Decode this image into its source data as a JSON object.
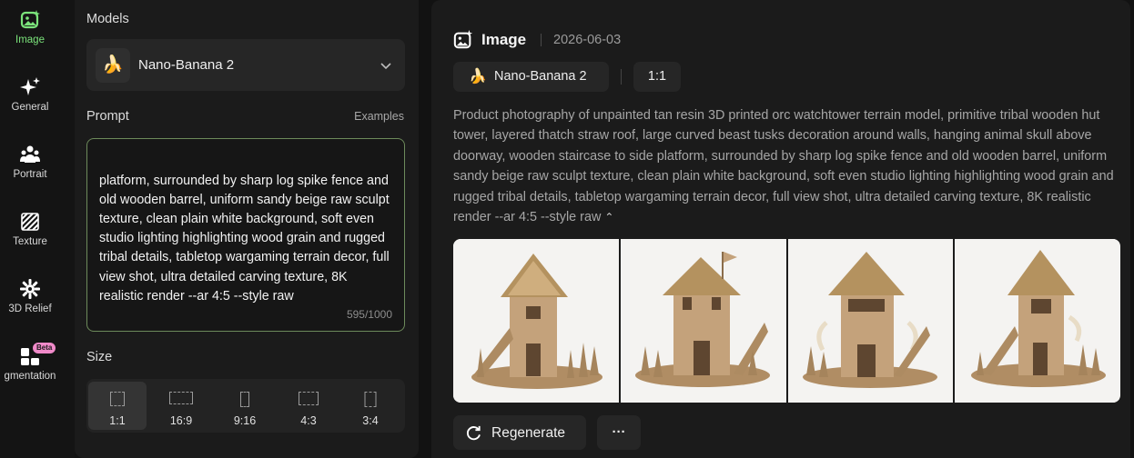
{
  "nav": {
    "items": [
      {
        "label": "Image",
        "icon": "image-sparkle-icon",
        "active": true
      },
      {
        "label": "General",
        "icon": "sparkle-icon"
      },
      {
        "label": "Portrait",
        "icon": "people-icon"
      },
      {
        "label": "Texture",
        "icon": "hatch-icon"
      },
      {
        "label": "3D Relief",
        "icon": "gear-star-icon"
      },
      {
        "label": "gmentation",
        "icon": "segmentation-icon",
        "badge": "Beta"
      }
    ]
  },
  "panel": {
    "models_title": "Models",
    "model_name": "Nano-Banana 2",
    "model_emoji": "🍌",
    "prompt_title": "Prompt",
    "examples_label": "Examples",
    "prompt_text": "platform, surrounded by sharp log spike fence and old wooden barrel, uniform sandy beige raw sculpt texture, clean plain white background, soft even studio lighting highlighting wood grain and rugged tribal details, tabletop wargaming terrain decor, full view shot, ultra detailed carving texture, 8K realistic render --ar 4:5 --style raw",
    "counter": "595/1000",
    "size_title": "Size",
    "sizes": [
      {
        "label": "1:1",
        "active": true
      },
      {
        "label": "16:9"
      },
      {
        "label": "9:16"
      },
      {
        "label": "4:3"
      },
      {
        "label": "3:4"
      }
    ]
  },
  "main": {
    "title": "Image",
    "date": "2026-06-03",
    "model_chip": "Nano-Banana 2",
    "ratio_chip": "1:1",
    "description": "Product photography of unpainted tan resin 3D printed orc watchtower terrain model, primitive tribal wooden hut tower, layered thatch straw roof, large curved beast tusks decoration around walls, hanging animal skull above doorway, wooden staircase to side platform, surrounded by sharp log spike fence and old wooden barrel, uniform sandy beige raw sculpt texture, clean plain white background, soft even studio lighting highlighting wood grain and rugged tribal details, tabletop wargaming terrain decor, full view shot, ultra detailed carving texture, 8K realistic render --ar 4:5 --style raw",
    "collapse_glyph": "⌃",
    "regenerate_label": "Regenerate",
    "more_glyph": "···"
  },
  "colors": {
    "accent": "#7be37b",
    "terrain": "#c4a27b",
    "photo_bg": "#f4f3f1"
  }
}
